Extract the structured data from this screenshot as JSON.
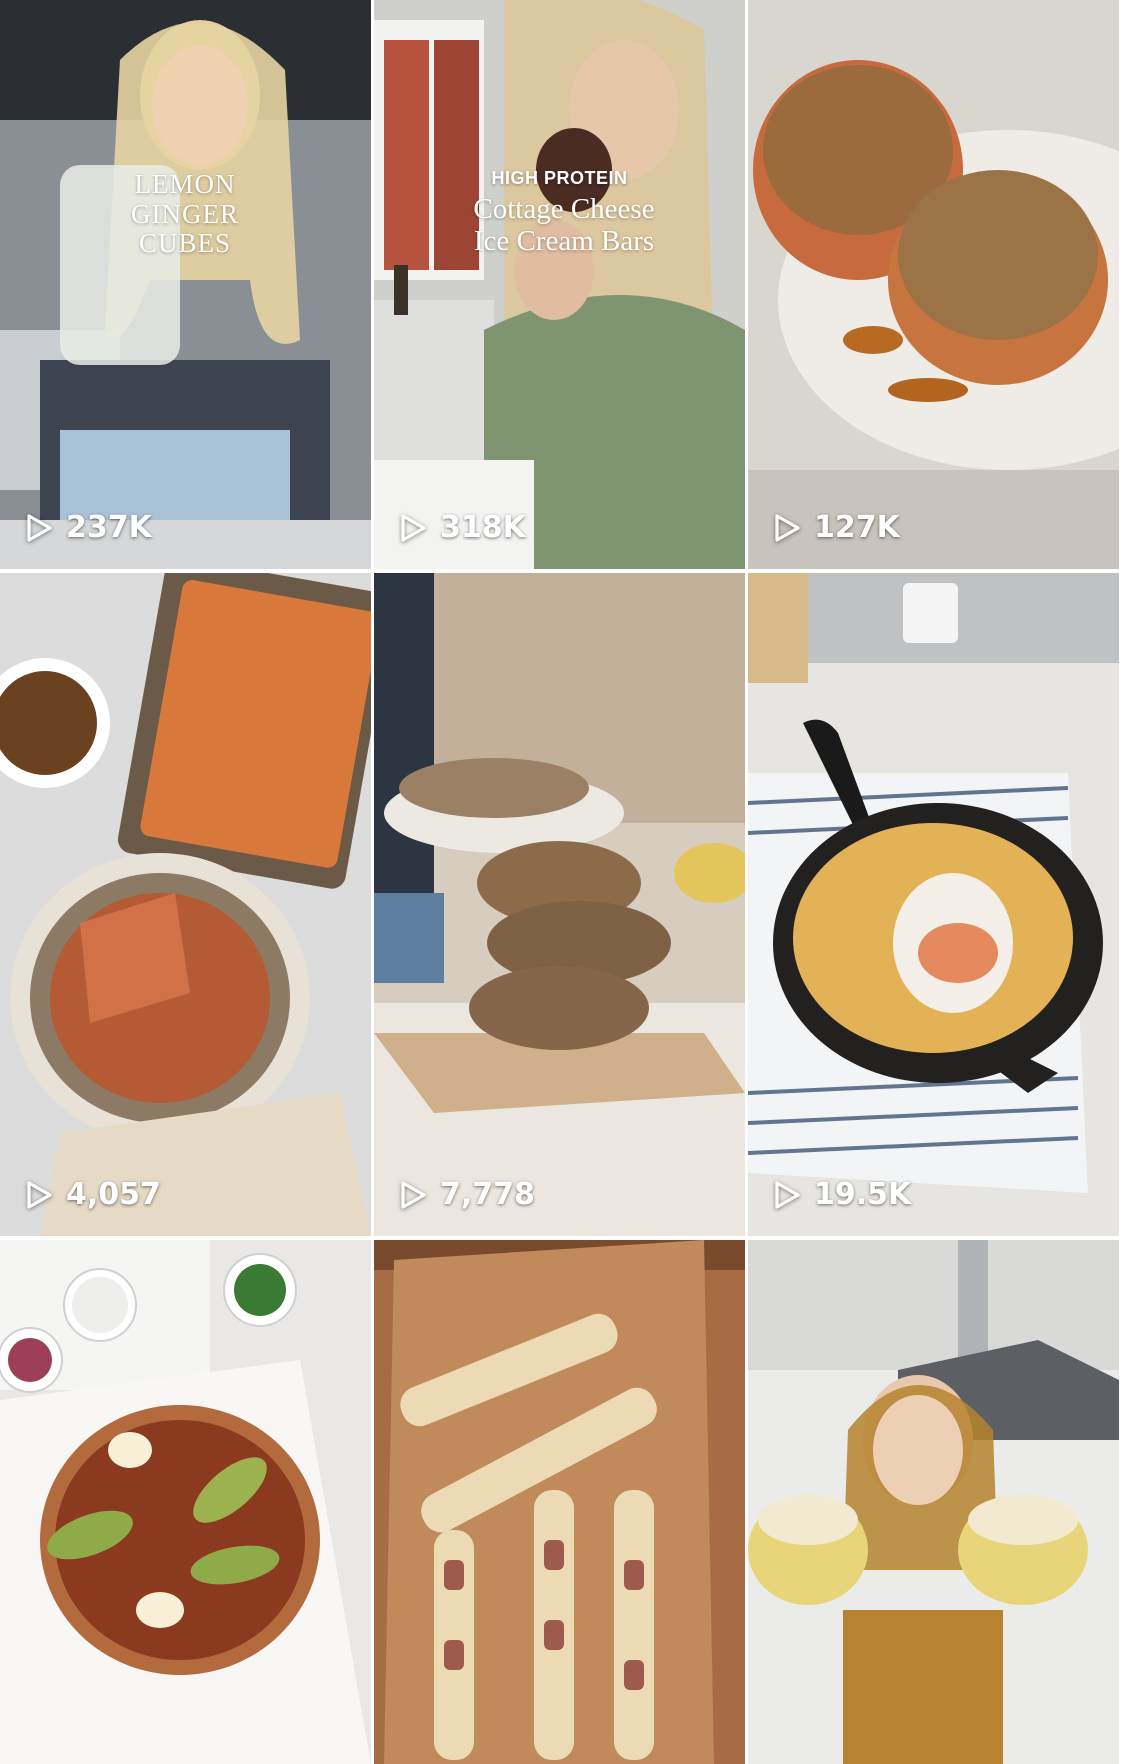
{
  "grid": {
    "tiles": [
      {
        "views": "237K",
        "overlay": "LEMON\nGINGER\nCUBES"
      },
      {
        "views": "318K",
        "overlay_kicker": "HIGH PROTEIN",
        "overlay": "Cottage Cheese\nIce Cream Bars"
      },
      {
        "views": "127K"
      },
      {
        "views": "4,057"
      },
      {
        "views": "7,778"
      },
      {
        "views": "19.5K"
      },
      {},
      {},
      {}
    ]
  },
  "icons": {
    "views": "play-outline-icon"
  },
  "colors": {
    "overlay_text": "#ffffff"
  }
}
